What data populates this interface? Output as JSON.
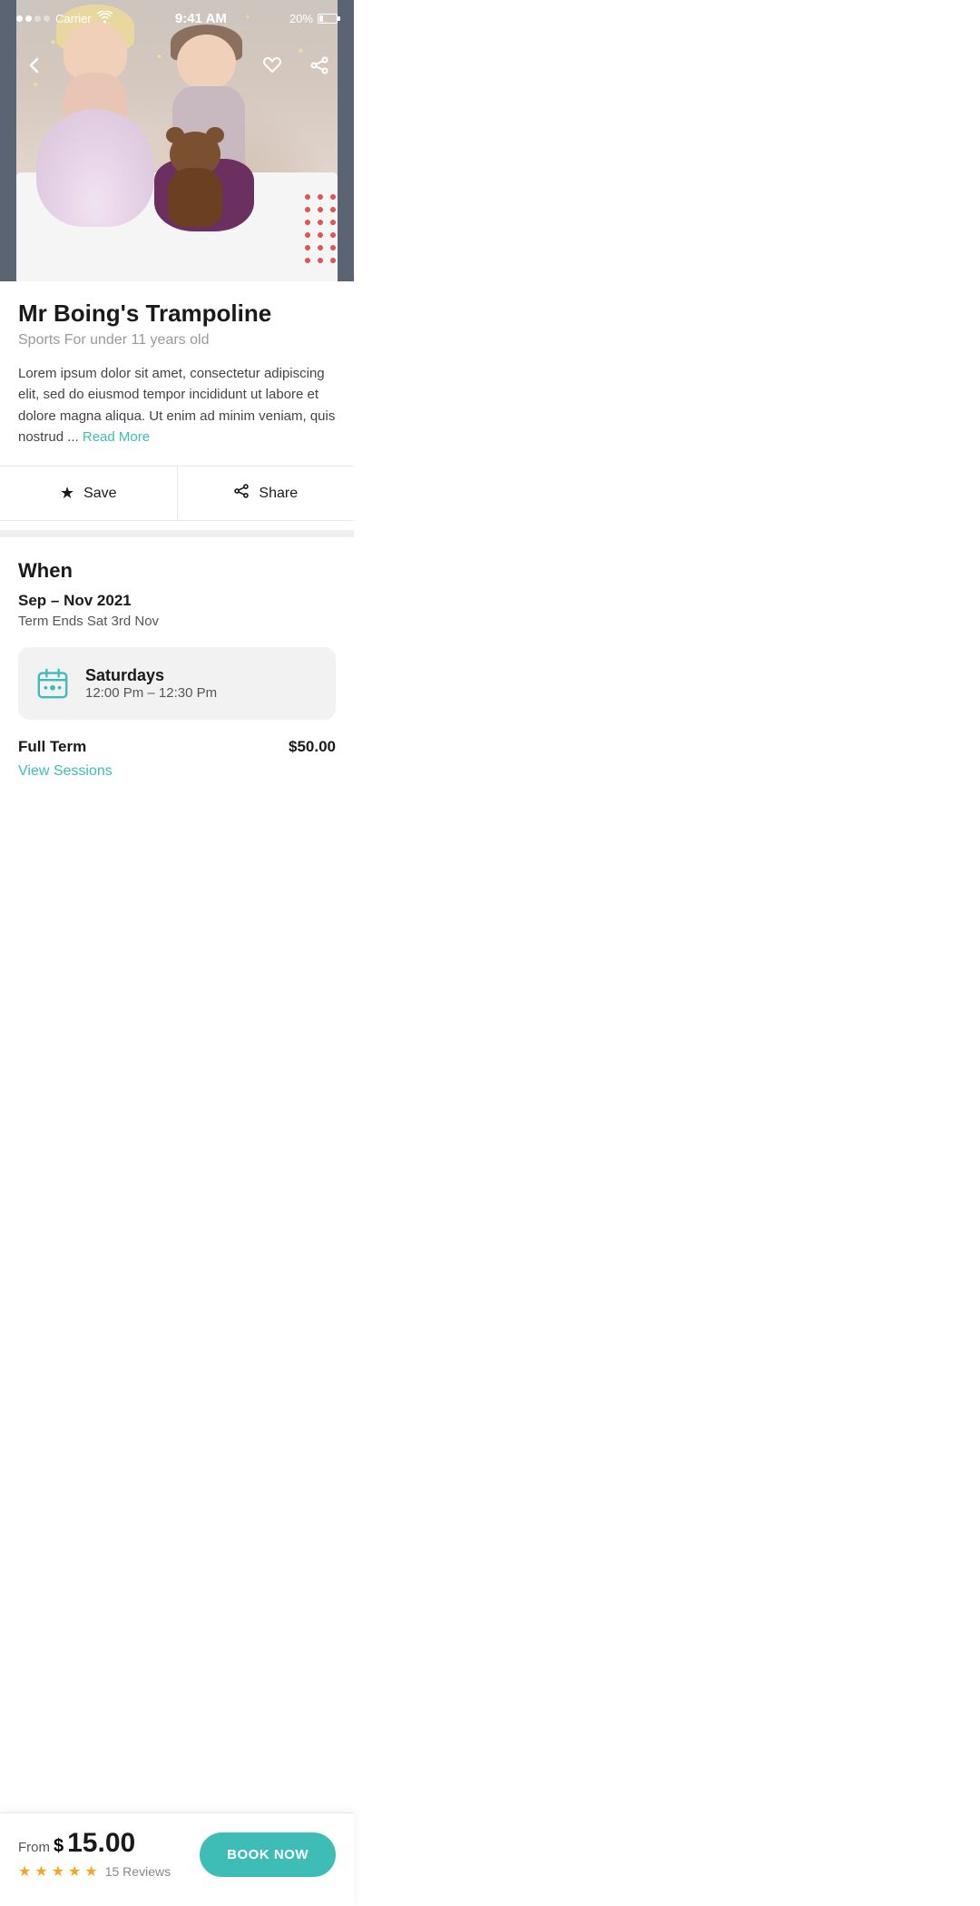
{
  "statusBar": {
    "carrier": "Carrier",
    "time": "9:41 AM",
    "battery": "20%",
    "signal": 2,
    "signalMax": 4
  },
  "nav": {
    "backLabel": "‹",
    "saveLabel": "★",
    "shareLabel": "⎋"
  },
  "venue": {
    "title": "Mr Boing's Trampoline",
    "subtitle": "Sports For under 11 years old",
    "description": "Lorem ipsum dolor sit amet, consectetur adipiscing elit, sed do eiusmod tempor incididunt ut labore et dolore magna aliqua. Ut enim ad minim veniam, quis nostrud ...",
    "readMore": "Read More"
  },
  "actions": {
    "save": "Save",
    "share": "Share"
  },
  "when": {
    "sectionTitle": "When",
    "dateRange": "Sep – Nov 2021",
    "termEnds": "Term Ends Sat 3rd Nov"
  },
  "schedule": {
    "day": "Saturdays",
    "timeRange": "12:00 Pm – 12:30 Pm"
  },
  "pricing": {
    "label": "Full Term",
    "price": "$50.00",
    "viewSessions": "View Sessions"
  },
  "bottomBar": {
    "fromLabel": "From",
    "dollarSign": "$",
    "price": "15.00",
    "stars": 5,
    "reviewsCount": "15 Reviews",
    "bookNow": "BOOK NOW"
  },
  "colors": {
    "teal": "#3dbdb5",
    "star": "#f5a623",
    "dark": "#1a1a1a",
    "gray": "#999999"
  }
}
